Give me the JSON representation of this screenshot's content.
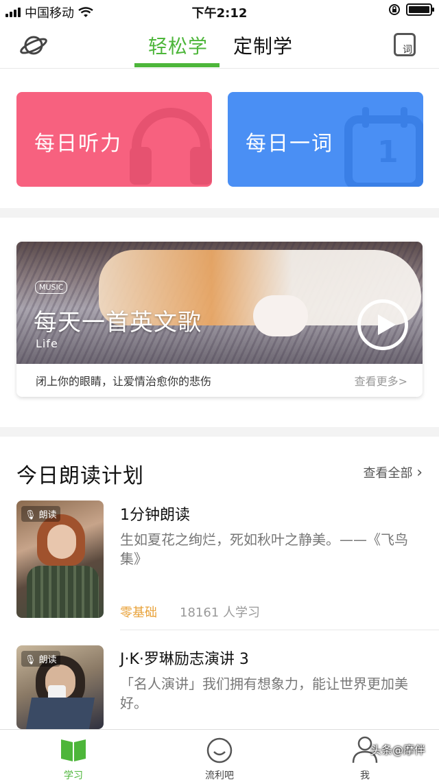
{
  "status_bar": {
    "carrier": "中国移动",
    "time": "下午2:12"
  },
  "header": {
    "tabs": [
      {
        "label": "轻松学",
        "active": true
      },
      {
        "label": "定制学",
        "active": false
      }
    ],
    "vocab_icon_label": "词"
  },
  "cards": [
    {
      "label": "每日听力",
      "color": "#f7617f"
    },
    {
      "label": "每日一词",
      "color": "#4a8ff4",
      "calendar_number": "1"
    }
  ],
  "music": {
    "tag": "MUSIC",
    "title": "每天一首英文歌",
    "subtitle": "Life",
    "caption": "闭上你的眼睛，让爱情治愈你的悲伤",
    "more": "查看更多>"
  },
  "plan": {
    "title": "今日朗读计划",
    "more": "查看全部",
    "items": [
      {
        "badge": "朗读",
        "title": "1分钟朗读",
        "desc": "生如夏花之绚烂，死如秋叶之静美。——《飞鸟集》",
        "level": "零基础",
        "learners": "18161 人学习"
      },
      {
        "badge": "朗读",
        "title": "J·K·罗琳励志演讲 3",
        "desc": "「名人演讲」我们拥有想象力，能让世界更加美好。"
      }
    ]
  },
  "tabbar": [
    {
      "label": "学习",
      "active": true
    },
    {
      "label": "流利吧",
      "active": false
    },
    {
      "label": "我",
      "active": false
    }
  ],
  "watermark": "头条@摩伴",
  "colors": {
    "accent": "#4db63a",
    "listening_card": "#f7617f",
    "word_card": "#4a8ff4",
    "level": "#e8a23a"
  }
}
